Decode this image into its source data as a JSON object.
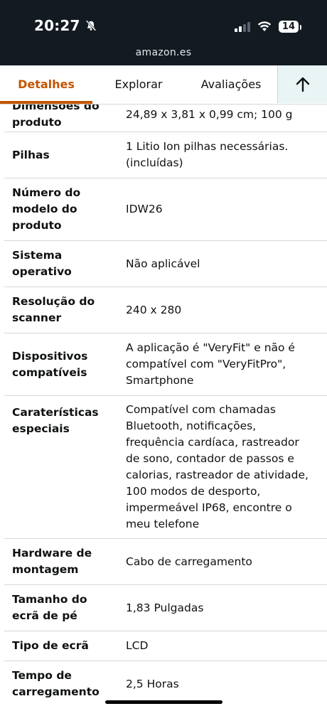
{
  "status_bar": {
    "time": "20:27",
    "battery": "14"
  },
  "browser": {
    "url": "amazon.es"
  },
  "tabs": [
    {
      "label": "Detalhes",
      "active": true
    },
    {
      "label": "Explorar",
      "active": false
    },
    {
      "label": "Avaliações",
      "active": false
    }
  ],
  "colors": {
    "accent": "#c45500",
    "top_bar": "#131a22",
    "back_to_top_bg": "#e9f5f4"
  },
  "details_table": [
    {
      "label": "Dimensões do produto",
      "value": "24,89 x 3,81 x 0,99 cm; 100 g"
    },
    {
      "label": "Pilhas",
      "value": "1 Litio Ion pilhas necessárias. (incluídas)"
    },
    {
      "label": "Número do modelo do produto",
      "value": "IDW26"
    },
    {
      "label": "Sistema operativo",
      "value": "Não aplicável"
    },
    {
      "label": "Resolução do scanner",
      "value": "240 x 280"
    },
    {
      "label": "Dispositivos compatíveis",
      "value": "A aplicação é \"VeryFit\" e não é compatível com \"VeryFitPro\", Smartphone"
    },
    {
      "label": "Caraterísticas especiais",
      "value": "Compatível com chamadas Bluetooth, notificações, frequência cardíaca, rastreador de sono, contador de passos e calorias, rastreador de atividade, 100 modos de desporto, impermeável IP68, encontre o meu telefone"
    },
    {
      "label": "Hardware de montagem",
      "value": "Cabo de carregamento"
    },
    {
      "label": "Tamanho do ecrã de pé",
      "value": "1,83 Pulgadas"
    },
    {
      "label": "Tipo de ecrã",
      "value": "LCD"
    },
    {
      "label": "Tempo de carregamento",
      "value": "2,5 Horas"
    }
  ]
}
